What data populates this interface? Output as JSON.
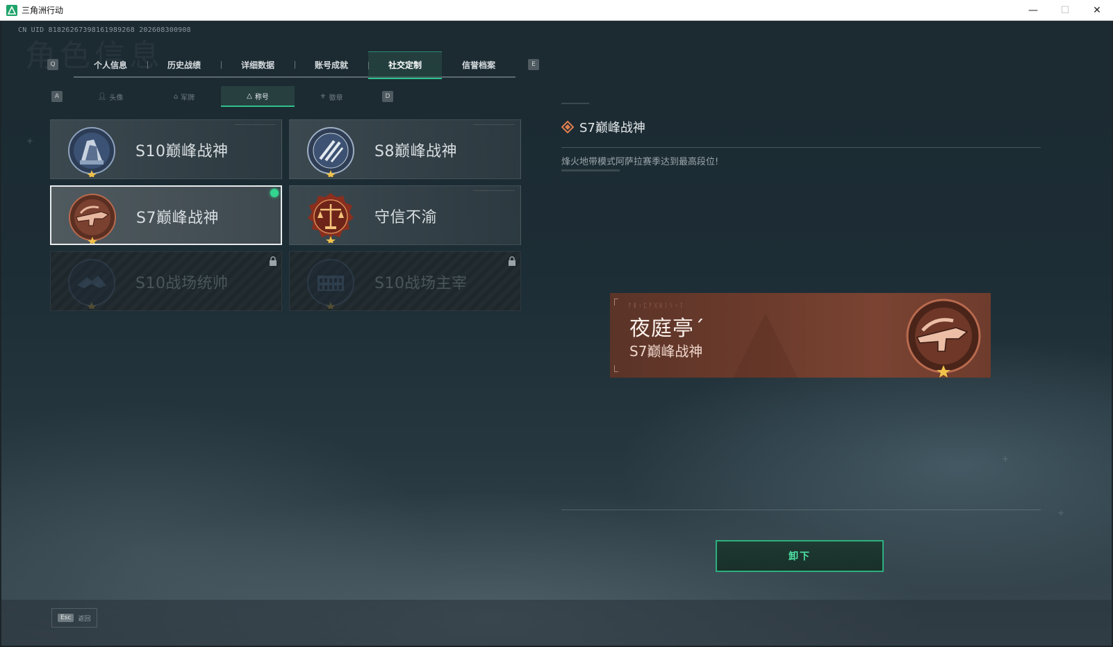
{
  "window": {
    "title": "三角洲行动",
    "minimize": "—",
    "maximize": "☐",
    "close": "✕"
  },
  "uid": "CN UID 818262673981619892​68 202608300908",
  "bg_title": "角色信息",
  "tabs": {
    "prev_key": "Q",
    "next_key": "E",
    "items": [
      {
        "label": "个人信息"
      },
      {
        "label": "历史战绩"
      },
      {
        "label": "详细数据"
      },
      {
        "label": "账号成就"
      },
      {
        "label": "社交定制",
        "active": true
      },
      {
        "label": "信誉档案"
      }
    ]
  },
  "subtabs": {
    "prev_key": "A",
    "next_key": "D",
    "items": [
      {
        "label": "头像",
        "icon": "person-icon"
      },
      {
        "label": "军牌",
        "icon": "dogtag-icon"
      },
      {
        "label": "称号",
        "icon": "triangle-icon",
        "active": true
      },
      {
        "label": "徽章",
        "icon": "emblem-icon"
      }
    ]
  },
  "cards": [
    {
      "label": "S10巅峰战神",
      "badge": "s10-peak-badge",
      "state": "normal"
    },
    {
      "label": "S8巅峰战神",
      "badge": "s8-peak-badge",
      "state": "normal"
    },
    {
      "label": "S7巅峰战神",
      "badge": "s7-peak-badge",
      "state": "selected",
      "equipped": true
    },
    {
      "label": "守信不渝",
      "badge": "scales-badge",
      "state": "normal"
    },
    {
      "label": "S10战场统帅",
      "badge": "s10-commander-badge",
      "state": "locked"
    },
    {
      "label": "S10战场主宰",
      "badge": "s10-dominator-badge",
      "state": "locked"
    }
  ],
  "detail": {
    "title": "S7巅峰战神",
    "description": "烽火地带模式阿萨拉赛季达到最高段位!"
  },
  "preview": {
    "runes": "ᚨᛒᚲᛈᚠᚷᚺᛁᛊᚲᛚ",
    "player_name": "夜庭亭ˊ",
    "title": "S7巅峰战神"
  },
  "action": {
    "unequip_label": "卸下"
  },
  "footer": {
    "esc_key": "Esc",
    "esc_label": "返回"
  },
  "colors": {
    "accent_green": "#2dc28d",
    "equipped_dot": "#33d48f",
    "nameplate_bronze": "#6c3b2c"
  }
}
